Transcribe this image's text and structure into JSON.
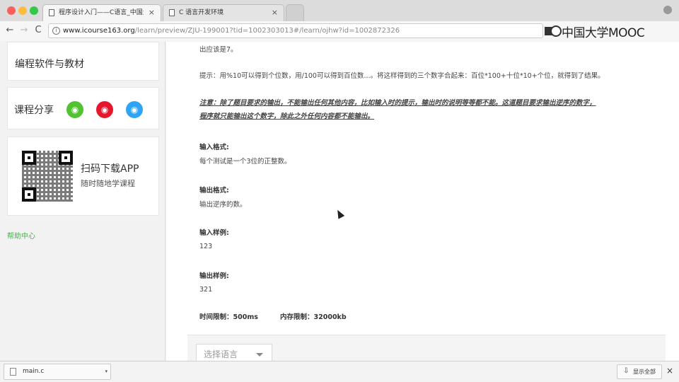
{
  "browser": {
    "tabs": [
      {
        "label": "程序设计入门——C语言_中国大",
        "close": "×"
      },
      {
        "label": "C 语言开发环境",
        "close": "×"
      }
    ],
    "nav": {
      "back": "←",
      "forward": "→",
      "reload": "C"
    },
    "url_host": "www.icourse163.org",
    "url_path": "/learn/preview/ZJU-199001?tid=1002303013#/learn/ojhw?id=1002872326",
    "info_icon": "i",
    "logo_text": "中国大学MOOC"
  },
  "sidebar": {
    "tools_title": "编程软件与教材",
    "share_title": "课程分享",
    "share_icons": {
      "wechat": "◉",
      "weibo": "◉",
      "qq": "◉"
    },
    "app_title": "扫码下载APP",
    "app_subtitle": "随时随地学课程",
    "help_link": "帮助中心"
  },
  "problem": {
    "output_tail": "出应该是7。",
    "hint": "提示：用%10可以得到个位数，用/100可以得到百位数...。将这样得到的三个数字合起来：百位*100+十位*10+个位，就得到了结果。",
    "note_line1": "注意：除了题目要求的输出，不能输出任何其他内容，比如输入时的提示，输出时的说明等等都不能。这道题目要求输出逆序的数字，",
    "note_line2": "程序就只能输出这个数字，除此之外任何内容都不能输出。",
    "input_format_label": "输入格式:",
    "input_format": "每个测试是一个3位的正整数。",
    "output_format_label": "输出格式:",
    "output_format": "输出逆序的数。",
    "input_sample_label": "输入样例:",
    "input_sample": "123",
    "output_sample_label": "输出样例:",
    "output_sample": "321",
    "time_limit": "时间限制：500ms",
    "memory_limit": "内存限制：32000kb"
  },
  "language_select": {
    "placeholder": "选择语言"
  },
  "downloads": {
    "file_name": "main.c",
    "menu_glyph": "▾",
    "show_all": "显示全部",
    "download_glyph": "⇩",
    "close": "×"
  }
}
